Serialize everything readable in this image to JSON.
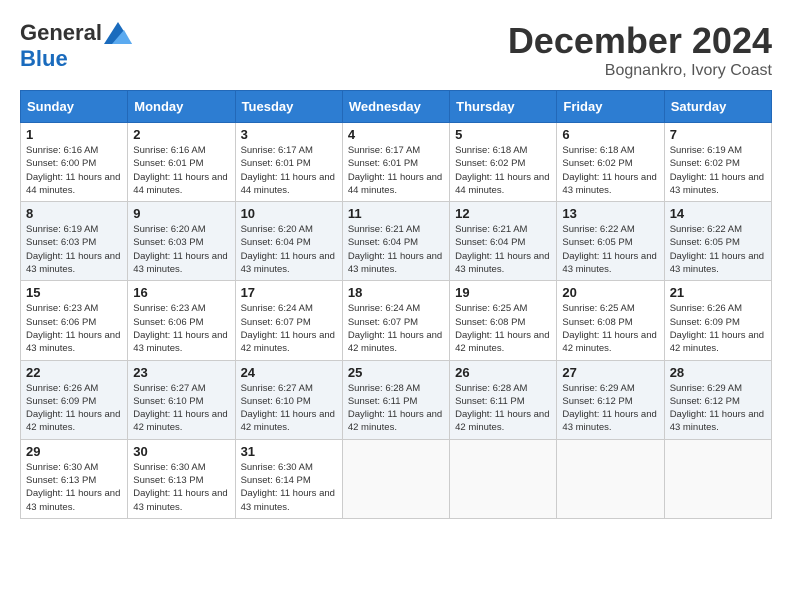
{
  "logo": {
    "general": "General",
    "blue": "Blue"
  },
  "title": {
    "month_year": "December 2024",
    "location": "Bognankro, Ivory Coast"
  },
  "weekdays": [
    "Sunday",
    "Monday",
    "Tuesday",
    "Wednesday",
    "Thursday",
    "Friday",
    "Saturday"
  ],
  "weeks": [
    [
      {
        "day": "1",
        "sunrise": "6:16 AM",
        "sunset": "6:00 PM",
        "daylight": "11 hours and 44 minutes."
      },
      {
        "day": "2",
        "sunrise": "6:16 AM",
        "sunset": "6:01 PM",
        "daylight": "11 hours and 44 minutes."
      },
      {
        "day": "3",
        "sunrise": "6:17 AM",
        "sunset": "6:01 PM",
        "daylight": "11 hours and 44 minutes."
      },
      {
        "day": "4",
        "sunrise": "6:17 AM",
        "sunset": "6:01 PM",
        "daylight": "11 hours and 44 minutes."
      },
      {
        "day": "5",
        "sunrise": "6:18 AM",
        "sunset": "6:02 PM",
        "daylight": "11 hours and 44 minutes."
      },
      {
        "day": "6",
        "sunrise": "6:18 AM",
        "sunset": "6:02 PM",
        "daylight": "11 hours and 43 minutes."
      },
      {
        "day": "7",
        "sunrise": "6:19 AM",
        "sunset": "6:02 PM",
        "daylight": "11 hours and 43 minutes."
      }
    ],
    [
      {
        "day": "8",
        "sunrise": "6:19 AM",
        "sunset": "6:03 PM",
        "daylight": "11 hours and 43 minutes."
      },
      {
        "day": "9",
        "sunrise": "6:20 AM",
        "sunset": "6:03 PM",
        "daylight": "11 hours and 43 minutes."
      },
      {
        "day": "10",
        "sunrise": "6:20 AM",
        "sunset": "6:04 PM",
        "daylight": "11 hours and 43 minutes."
      },
      {
        "day": "11",
        "sunrise": "6:21 AM",
        "sunset": "6:04 PM",
        "daylight": "11 hours and 43 minutes."
      },
      {
        "day": "12",
        "sunrise": "6:21 AM",
        "sunset": "6:04 PM",
        "daylight": "11 hours and 43 minutes."
      },
      {
        "day": "13",
        "sunrise": "6:22 AM",
        "sunset": "6:05 PM",
        "daylight": "11 hours and 43 minutes."
      },
      {
        "day": "14",
        "sunrise": "6:22 AM",
        "sunset": "6:05 PM",
        "daylight": "11 hours and 43 minutes."
      }
    ],
    [
      {
        "day": "15",
        "sunrise": "6:23 AM",
        "sunset": "6:06 PM",
        "daylight": "11 hours and 43 minutes."
      },
      {
        "day": "16",
        "sunrise": "6:23 AM",
        "sunset": "6:06 PM",
        "daylight": "11 hours and 43 minutes."
      },
      {
        "day": "17",
        "sunrise": "6:24 AM",
        "sunset": "6:07 PM",
        "daylight": "11 hours and 42 minutes."
      },
      {
        "day": "18",
        "sunrise": "6:24 AM",
        "sunset": "6:07 PM",
        "daylight": "11 hours and 42 minutes."
      },
      {
        "day": "19",
        "sunrise": "6:25 AM",
        "sunset": "6:08 PM",
        "daylight": "11 hours and 42 minutes."
      },
      {
        "day": "20",
        "sunrise": "6:25 AM",
        "sunset": "6:08 PM",
        "daylight": "11 hours and 42 minutes."
      },
      {
        "day": "21",
        "sunrise": "6:26 AM",
        "sunset": "6:09 PM",
        "daylight": "11 hours and 42 minutes."
      }
    ],
    [
      {
        "day": "22",
        "sunrise": "6:26 AM",
        "sunset": "6:09 PM",
        "daylight": "11 hours and 42 minutes."
      },
      {
        "day": "23",
        "sunrise": "6:27 AM",
        "sunset": "6:10 PM",
        "daylight": "11 hours and 42 minutes."
      },
      {
        "day": "24",
        "sunrise": "6:27 AM",
        "sunset": "6:10 PM",
        "daylight": "11 hours and 42 minutes."
      },
      {
        "day": "25",
        "sunrise": "6:28 AM",
        "sunset": "6:11 PM",
        "daylight": "11 hours and 42 minutes."
      },
      {
        "day": "26",
        "sunrise": "6:28 AM",
        "sunset": "6:11 PM",
        "daylight": "11 hours and 42 minutes."
      },
      {
        "day": "27",
        "sunrise": "6:29 AM",
        "sunset": "6:12 PM",
        "daylight": "11 hours and 43 minutes."
      },
      {
        "day": "28",
        "sunrise": "6:29 AM",
        "sunset": "6:12 PM",
        "daylight": "11 hours and 43 minutes."
      }
    ],
    [
      {
        "day": "29",
        "sunrise": "6:30 AM",
        "sunset": "6:13 PM",
        "daylight": "11 hours and 43 minutes."
      },
      {
        "day": "30",
        "sunrise": "6:30 AM",
        "sunset": "6:13 PM",
        "daylight": "11 hours and 43 minutes."
      },
      {
        "day": "31",
        "sunrise": "6:30 AM",
        "sunset": "6:14 PM",
        "daylight": "11 hours and 43 minutes."
      },
      null,
      null,
      null,
      null
    ]
  ]
}
